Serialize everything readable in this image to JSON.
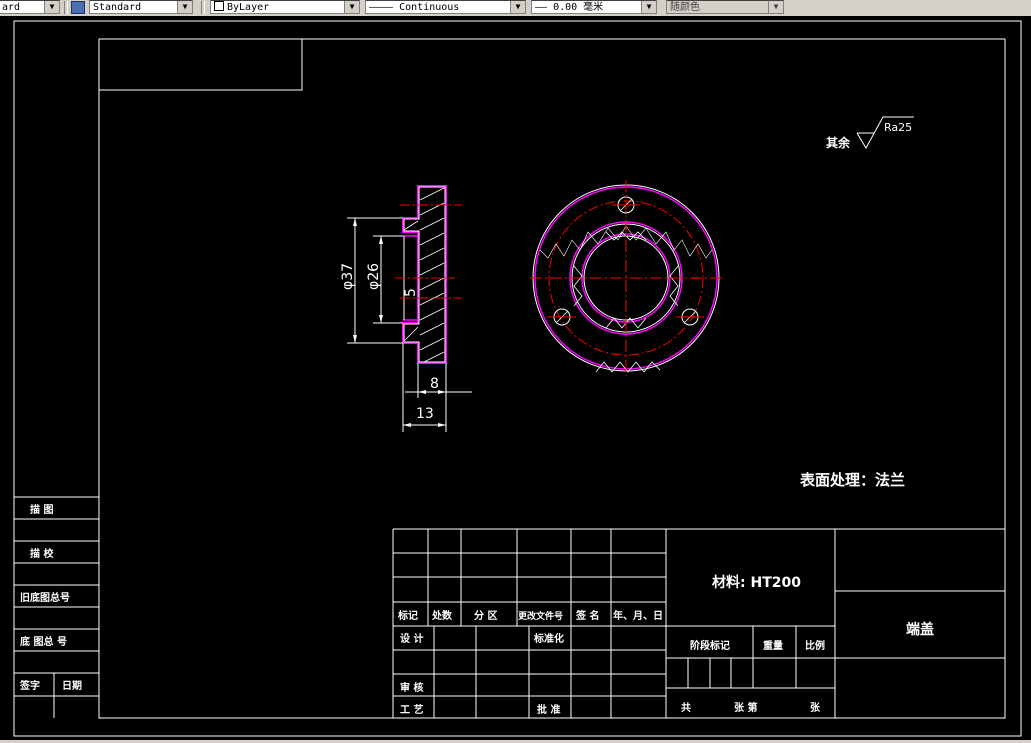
{
  "toolbar": {
    "text_style": "ard",
    "dim_style": "Standard",
    "layer_color": "ByLayer",
    "linetype": "Continuous",
    "lineweight": "0.00 毫米",
    "plot_style": "随颜色",
    "linetype_sample": "————",
    "lineweight_sample": "——"
  },
  "drawing": {
    "roughness_prefix": "其余",
    "roughness_value": "Ra25",
    "dims": {
      "d37": "φ37",
      "d26": "φ26",
      "d5": "5",
      "d8": "8",
      "d13": "13"
    },
    "surface_note": "表面处理：法兰"
  },
  "left_block": {
    "r1": "描 图",
    "r2": "描 校",
    "r3": "旧底图总号",
    "r4": "底 图总 号",
    "r5a": "签字",
    "r5b": "日期"
  },
  "title_block": {
    "rev_headers": [
      "标记",
      "处数",
      "分 区",
      "更改文件号",
      "签 名",
      "年、月、日"
    ],
    "design": "设 计",
    "standardize": "标准化",
    "review": "审 核",
    "process": "工 艺",
    "approve": "批 准",
    "material": "材料: HT200",
    "stage_mark": "阶段标记",
    "weight": "重量",
    "scale": "比例",
    "part_name": "端盖",
    "sheets_total": "共",
    "sheets_unit": "张 第",
    "sheets_end": "张"
  }
}
